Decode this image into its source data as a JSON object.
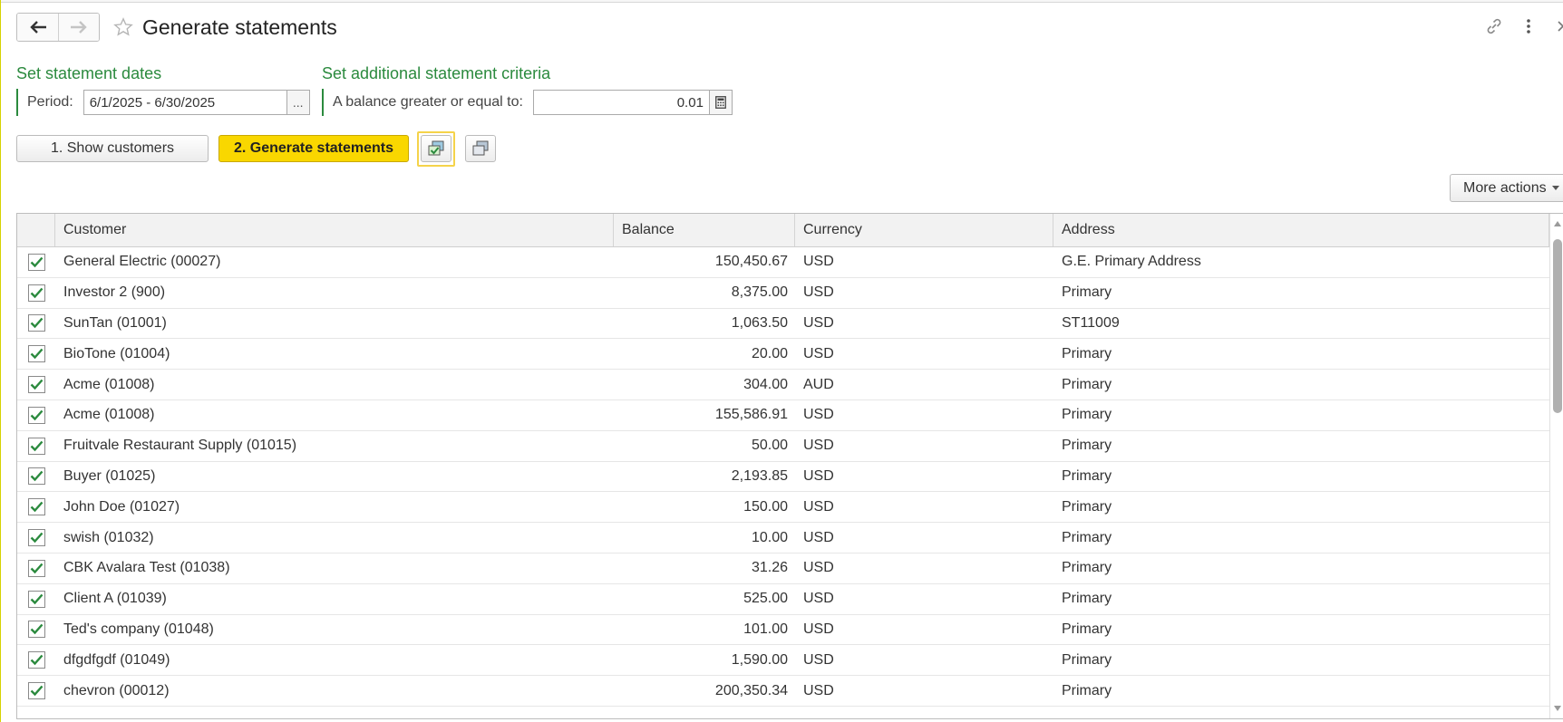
{
  "header": {
    "title": "Generate statements",
    "back_icon": "arrow-left-icon",
    "forward_icon": "arrow-right-icon",
    "favorite_icon": "star-icon",
    "link_icon": "link-icon",
    "menu_icon": "vertical-dots-icon",
    "close_icon": "close-icon"
  },
  "dates_section": {
    "title": "Set statement dates",
    "period_label": "Period:",
    "period_value": "6/1/2025 - 6/30/2025",
    "picker_label": "..."
  },
  "criteria_section": {
    "title": "Set additional statement criteria",
    "balance_label": "A balance greater or equal to:",
    "balance_value": "0.01",
    "calculator_icon": "calculator-icon"
  },
  "toolbar": {
    "show_customers_label": "1. Show customers",
    "generate_label": "2. Generate statements",
    "check_all_icon": "check-all-icon",
    "uncheck_all_icon": "uncheck-all-icon",
    "more_actions_label": "More actions"
  },
  "table": {
    "columns": [
      "Customer",
      "Balance",
      "Currency",
      "Address"
    ],
    "rows": [
      {
        "checked": true,
        "customer": "General Electric (00027)",
        "balance": "150,450.67",
        "currency": "USD",
        "address": "G.E. Primary Address"
      },
      {
        "checked": true,
        "customer": "Investor 2 (900)",
        "balance": "8,375.00",
        "currency": "USD",
        "address": "Primary"
      },
      {
        "checked": true,
        "customer": "SunTan (01001)",
        "balance": "1,063.50",
        "currency": "USD",
        "address": "ST11009"
      },
      {
        "checked": true,
        "customer": "BioTone (01004)",
        "balance": "20.00",
        "currency": "USD",
        "address": "Primary"
      },
      {
        "checked": true,
        "customer": "Acme (01008)",
        "balance": "304.00",
        "currency": "AUD",
        "address": "Primary"
      },
      {
        "checked": true,
        "customer": "Acme (01008)",
        "balance": "155,586.91",
        "currency": "USD",
        "address": "Primary"
      },
      {
        "checked": true,
        "customer": "Fruitvale Restaurant Supply (01015)",
        "balance": "50.00",
        "currency": "USD",
        "address": "Primary"
      },
      {
        "checked": true,
        "customer": "Buyer (01025)",
        "balance": "2,193.85",
        "currency": "USD",
        "address": "Primary"
      },
      {
        "checked": true,
        "customer": "John Doe (01027)",
        "balance": "150.00",
        "currency": "USD",
        "address": "Primary"
      },
      {
        "checked": true,
        "customer": "swish (01032)",
        "balance": "10.00",
        "currency": "USD",
        "address": "Primary"
      },
      {
        "checked": true,
        "customer": "CBK Avalara Test (01038)",
        "balance": "31.26",
        "currency": "USD",
        "address": "Primary"
      },
      {
        "checked": true,
        "customer": "Client A (01039)",
        "balance": "525.00",
        "currency": "USD",
        "address": "Primary"
      },
      {
        "checked": true,
        "customer": "Ted's company (01048)",
        "balance": "101.00",
        "currency": "USD",
        "address": "Primary"
      },
      {
        "checked": true,
        "customer": "dfgdfgdf (01049)",
        "balance": "1,590.00",
        "currency": "USD",
        "address": "Primary"
      },
      {
        "checked": true,
        "customer": "chevron (00012)",
        "balance": "200,350.34",
        "currency": "USD",
        "address": "Primary"
      }
    ]
  },
  "colors": {
    "accent_green": "#2b8a3e",
    "primary_button": "#f9d700",
    "focus_outline": "#f5d34a"
  }
}
